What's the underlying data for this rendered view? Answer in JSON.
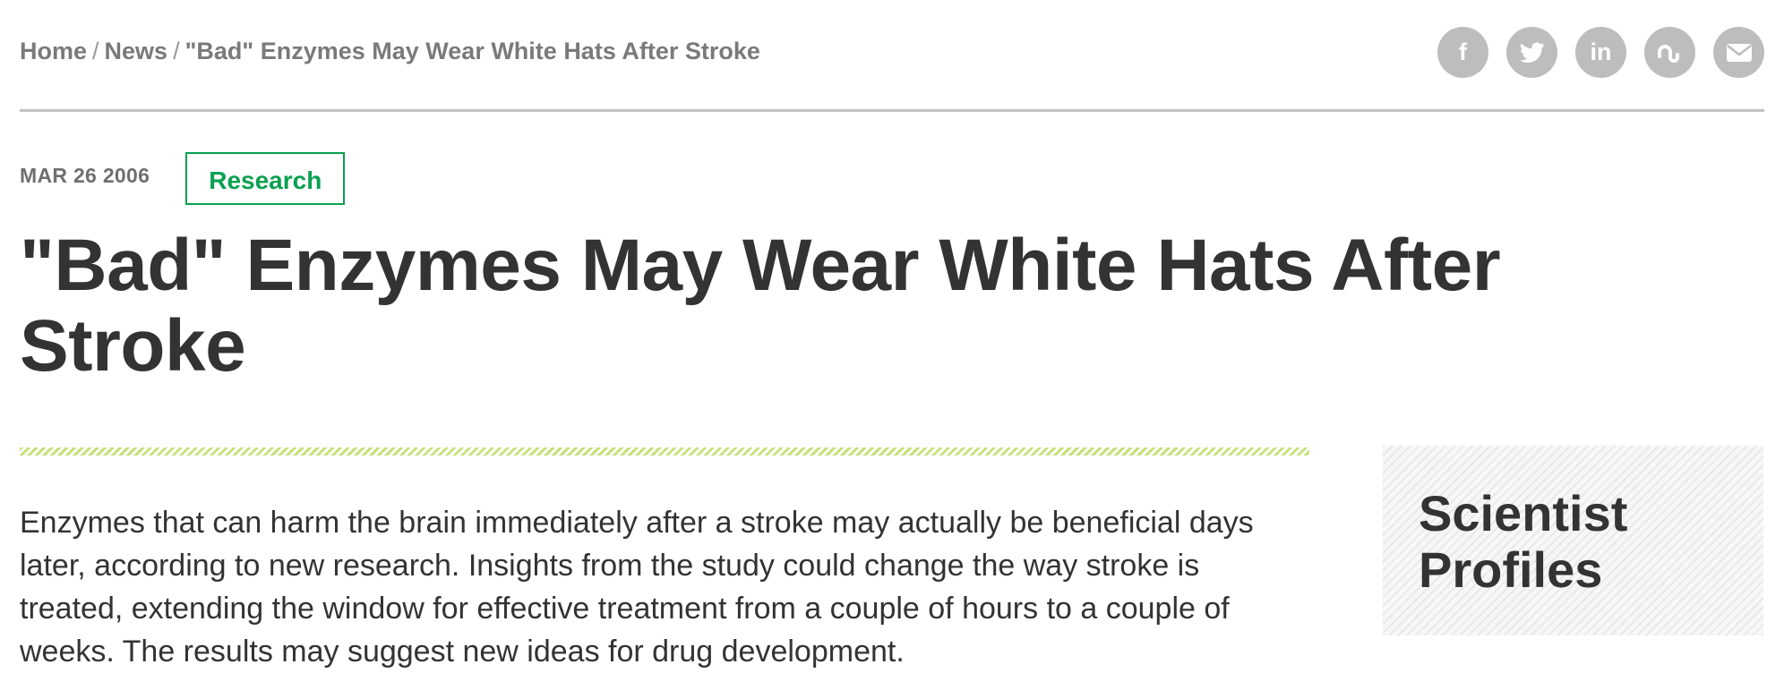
{
  "breadcrumb": {
    "home": "Home",
    "separator": "/",
    "news": "News",
    "current": "\"Bad\" Enzymes May Wear White Hats After Stroke"
  },
  "social": [
    {
      "icon": "facebook-icon",
      "glyph": "f"
    },
    {
      "icon": "twitter-icon",
      "glyph": "🐦"
    },
    {
      "icon": "linkedin-icon",
      "glyph": "in"
    },
    {
      "icon": "stumbleupon-icon",
      "glyph": "ꭍ"
    },
    {
      "icon": "email-icon",
      "glyph": "✉"
    }
  ],
  "article": {
    "date": "MAR 26 2006",
    "tag": "Research",
    "title": "\"Bad\" Enzymes May Wear White Hats After Stroke",
    "body": "Enzymes that can harm the brain immediately after a stroke may actually be beneficial days later, according to new research. Insights from the study could change the way stroke is treated, extending the window for effective treatment from a couple of hours to a couple of weeks. The results may suggest new ideas for drug development."
  },
  "sidebar": {
    "profiles_title": "Scientist Profiles"
  },
  "colors": {
    "accent_green": "#0aa050",
    "hatch_green": "#c6e27a",
    "icon_grey": "#bdbdbd"
  }
}
